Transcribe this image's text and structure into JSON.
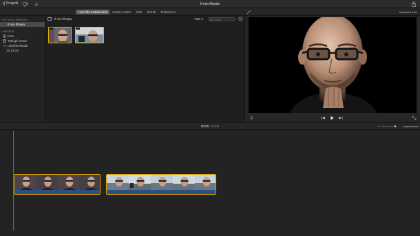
{
  "titlebar": {
    "back_label": "Progetti",
    "title": "Il mio filmato"
  },
  "toolbar": {
    "tabs": [
      {
        "label": "I miei file multimediali",
        "active": true
      },
      {
        "label": "Audio e video",
        "active": false
      },
      {
        "label": "Titoli",
        "active": false
      },
      {
        "label": "Sfondi",
        "active": false
      },
      {
        "label": "Transizioni",
        "active": false
      }
    ],
    "reset_all_label": "Inizializza tutto"
  },
  "sidebar": {
    "section_media": "FILE MULTIMEDIALI",
    "project_item": "Il mio filmato",
    "section_libraries": "LIBRERIE",
    "photos_item": "Foto",
    "all_events_item": "Tutti gli eventi",
    "library_item": "Libreria iMovie",
    "event_item": "12-12-23"
  },
  "browser": {
    "title": "Il mio filmato",
    "filter_value": "Tutti",
    "search_placeholder": "Cerca"
  },
  "timeline": {
    "current_time": "00:00",
    "separator": "/",
    "total_time": "00:08",
    "settings_label": "Impostazioni"
  },
  "colors": {
    "accent": "#e0b400",
    "audio_track": "#2c4f88",
    "selected_tab": "#5d5d5d"
  },
  "icons": [
    "chevron-left-icon",
    "media-import-icon",
    "download-icon",
    "share-icon",
    "enhance-wand-icon",
    "color-balance-icon",
    "color-correction-icon",
    "crop-icon",
    "stabilization-icon",
    "volume-icon",
    "noise-reduction-icon",
    "speed-icon",
    "filter-icon",
    "info-icon",
    "photos-icon",
    "events-icon",
    "search-icon",
    "settings-icon",
    "microphone-icon",
    "skip-back-icon",
    "play-icon",
    "skip-forward-icon",
    "fullscreen-icon"
  ]
}
